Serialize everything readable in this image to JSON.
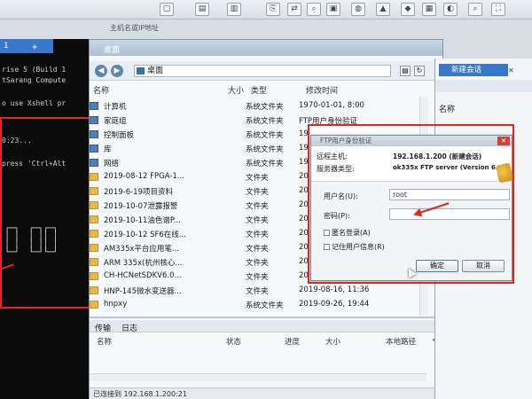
{
  "toolbar": {
    "address_placeholder": "主机名或IP地址"
  },
  "terminal": {
    "tab_label": "1",
    "lines": [
      "rise 5 (Build 1",
      "tSarang Compute",
      "o use Xshell pr",
      "0:23...",
      " press 'Ctrl+Alt"
    ],
    "art": " ┌─┐  ┌─┐┌─┐\n │ │  │ ││ │\n │ │  │ ││ │\n └─┘  └─┘└─┘"
  },
  "explorer": {
    "window_title": "桌面",
    "location": "桌面",
    "columns": {
      "name": "名称",
      "size": "大小",
      "type": "类型",
      "modified": "修改时间"
    },
    "rows": [
      {
        "name": "计算机",
        "type": "系统文件夹",
        "modified": "1970-01-01, 8:00",
        "icon": "computer-icon"
      },
      {
        "name": "家庭组",
        "type": "系统文件夹",
        "modified": "FTP用户身份验证",
        "icon": "homegroup-icon"
      },
      {
        "name": "控制面板",
        "type": "系统文件夹",
        "modified": "19",
        "icon": "control-panel-icon"
      },
      {
        "name": "库",
        "type": "系统文件夹",
        "modified": "19",
        "icon": "library-icon"
      },
      {
        "name": "网络",
        "type": "系统文件夹",
        "modified": "19",
        "icon": "network-icon"
      },
      {
        "name": "2019-08-12 FPGA-1...",
        "type": "文件夹",
        "modified": "20",
        "icon": "folder-icon"
      },
      {
        "name": "2019-6-19项目资料",
        "type": "文件夹",
        "modified": "20",
        "icon": "folder-icon"
      },
      {
        "name": "2019-10-07泄露报警",
        "type": "文件夹",
        "modified": "20",
        "icon": "folder-icon"
      },
      {
        "name": "2019-10-11油色谱P...",
        "type": "文件夹",
        "modified": "20",
        "icon": "folder-icon"
      },
      {
        "name": "2019-10-12 SF6在线...",
        "type": "文件夹",
        "modified": "20",
        "icon": "folder-icon"
      },
      {
        "name": "AM335x平台应用笔...",
        "type": "文件夹",
        "modified": "20",
        "icon": "folder-icon"
      },
      {
        "name": "ARM 335x(杭州核心...",
        "type": "文件夹",
        "modified": "20",
        "icon": "folder-icon"
      },
      {
        "name": "CH-HCNetSDKV6.0...",
        "type": "文件夹",
        "modified": "20",
        "icon": "folder-icon"
      },
      {
        "name": "HNP-145微水变送器...",
        "type": "文件夹",
        "modified": "2019-08-16, 11:36",
        "icon": "folder-icon"
      },
      {
        "name": "hnpxy",
        "type": "系统文件夹",
        "modified": "2019-09-26, 19:44",
        "icon": "folder-icon"
      }
    ],
    "bottom_tabs": [
      "传输",
      "日志"
    ],
    "bottom_columns": {
      "name": "名称",
      "status": "状态",
      "progress": "进度",
      "size": "大小",
      "local_path": "本地路径",
      "arrow": "<-"
    },
    "status_text": "已连接到 192.168.1.200:21"
  },
  "right_pane": {
    "tab_label": "新建会话",
    "column_name": "名称"
  },
  "dialog": {
    "title": "FTP用户身份验证",
    "remote_host_label": "远程主机:",
    "remote_host_value": "192.168.1.200 (新建会话)",
    "server_type_label": "服务器类型:",
    "server_type_value": "ok335x FTP server (Version 6.",
    "username_label": "用户名(U):",
    "username_value": "root",
    "password_label": "密码(P):",
    "password_value": "",
    "anonymous_label": "匿名登录(A)",
    "remember_label": "记住用户信息(R)",
    "ok_label": "确定",
    "cancel_label": "取消"
  },
  "annotation_color": "#e0261f"
}
